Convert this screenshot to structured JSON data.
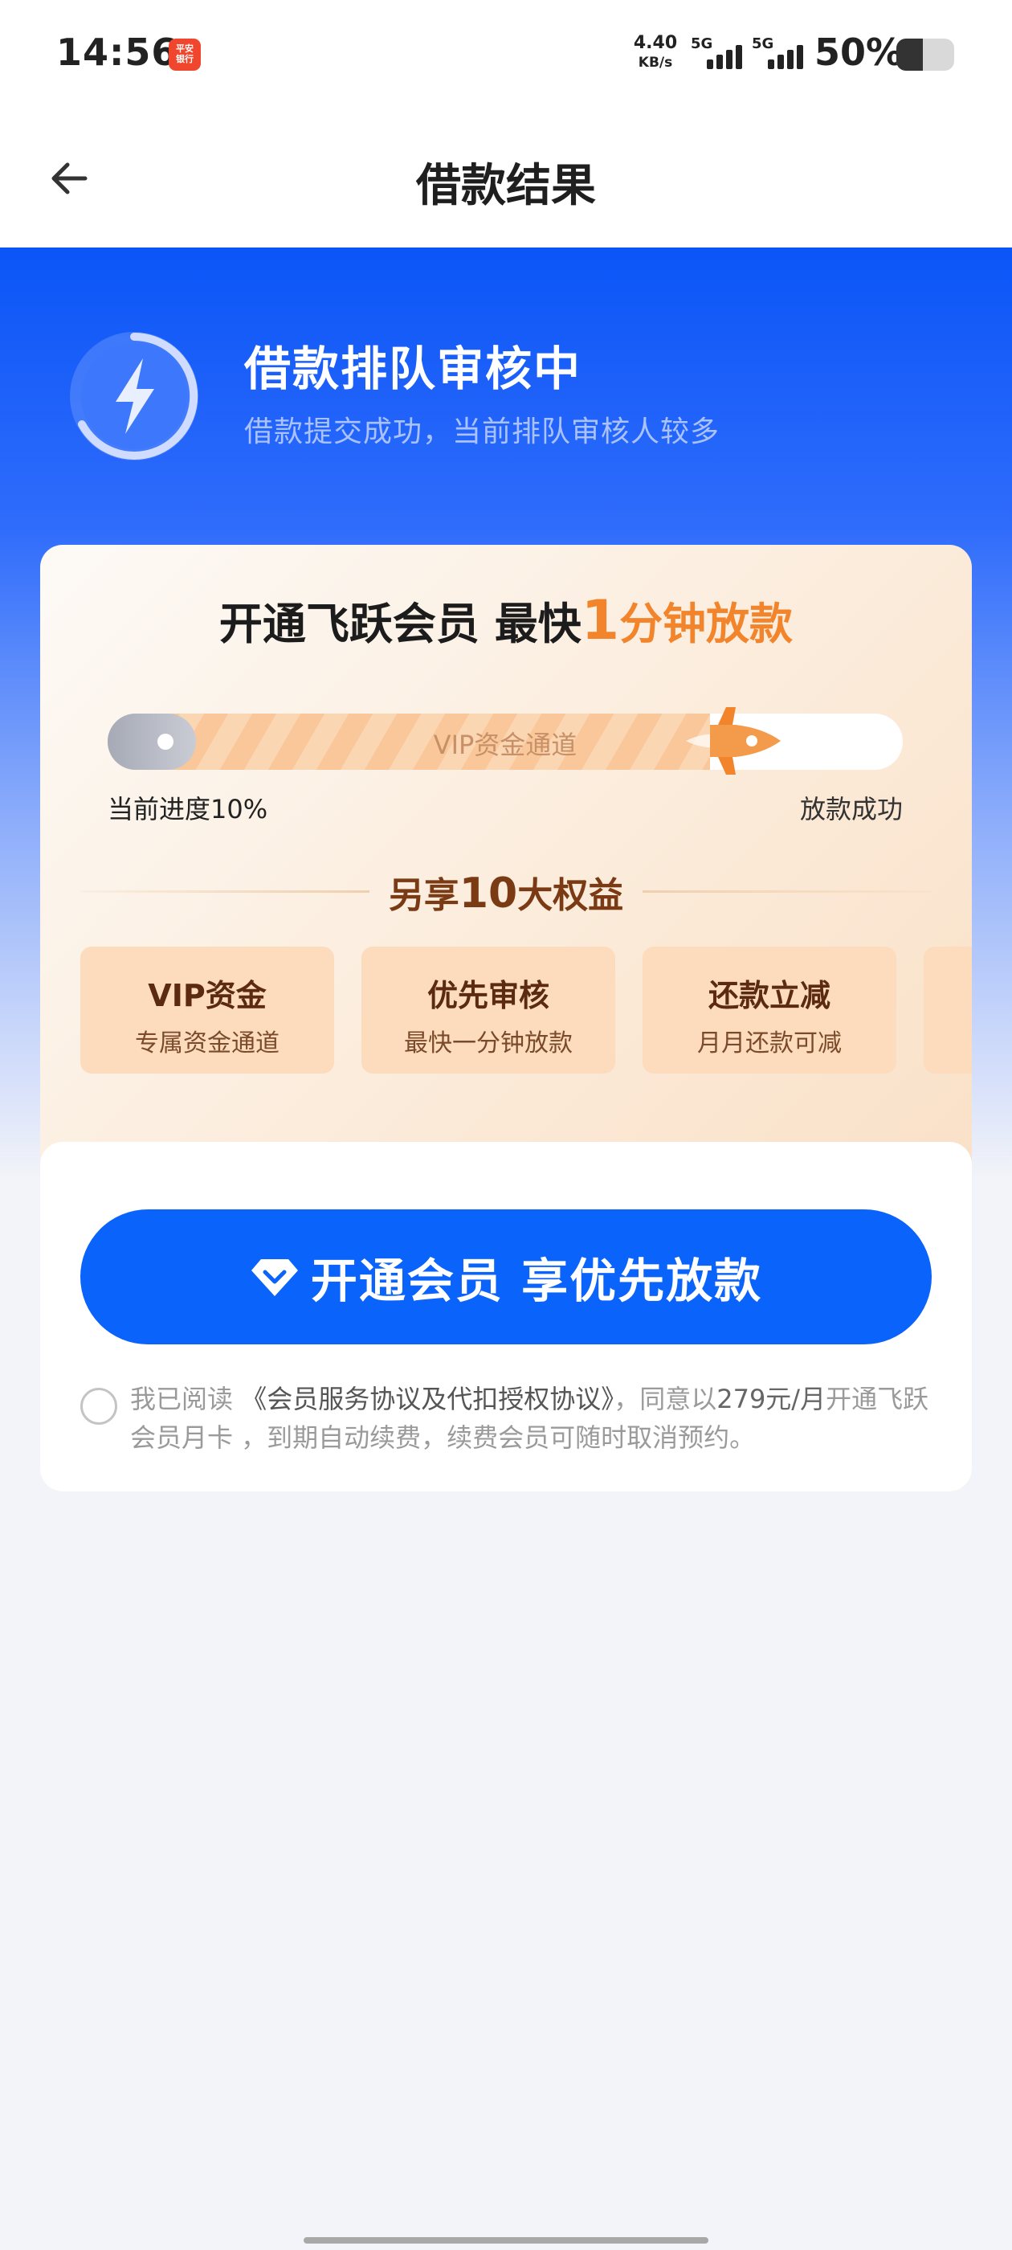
{
  "status_bar": {
    "time": "14:56",
    "app_badge": "平安\n银行",
    "net_speed_value": "4.40",
    "net_speed_unit": "KB/s",
    "signal_1_label": "5G",
    "signal_2_label": "5G",
    "battery_text": "50%",
    "battery_level": 0.5
  },
  "nav": {
    "title": "借款结果"
  },
  "hero": {
    "title": "借款排队审核中",
    "subtitle": "借款提交成功，当前排队审核人较多"
  },
  "promo": {
    "title_prefix": "开通飞跃会员 ",
    "title_hl_prefix": "最快",
    "title_num": "1",
    "title_suffix": "分钟放款",
    "progress_label": "VIP资金通道",
    "progress_left": "当前进度10%",
    "progress_right": "放款成功",
    "progress_value": 0.1,
    "benefit_head_prefix": "另享",
    "benefit_head_num": "10",
    "benefit_head_suffix": "大权益",
    "benefits": [
      {
        "title": "VIP资金",
        "sub": "专属资金通道"
      },
      {
        "title": "优先审核",
        "sub": "最快一分钟放款"
      },
      {
        "title": "还款立减",
        "sub": "月月还款可减"
      }
    ]
  },
  "cta": {
    "label": "开通会员 享优先放款"
  },
  "agreement": {
    "prefix": "我已阅读 ",
    "link": "《会员服务协议及代扣授权协议》",
    "middle": "，同意以",
    "price": "279元/月",
    "suffix": "开通飞跃会员月卡 ，到期自动续费，续费会员可随时取消预约。"
  },
  "colors": {
    "brand_blue": "#0a63fb",
    "accent_orange": "#f2852b",
    "benefit_bg": "#fcdcbd"
  }
}
